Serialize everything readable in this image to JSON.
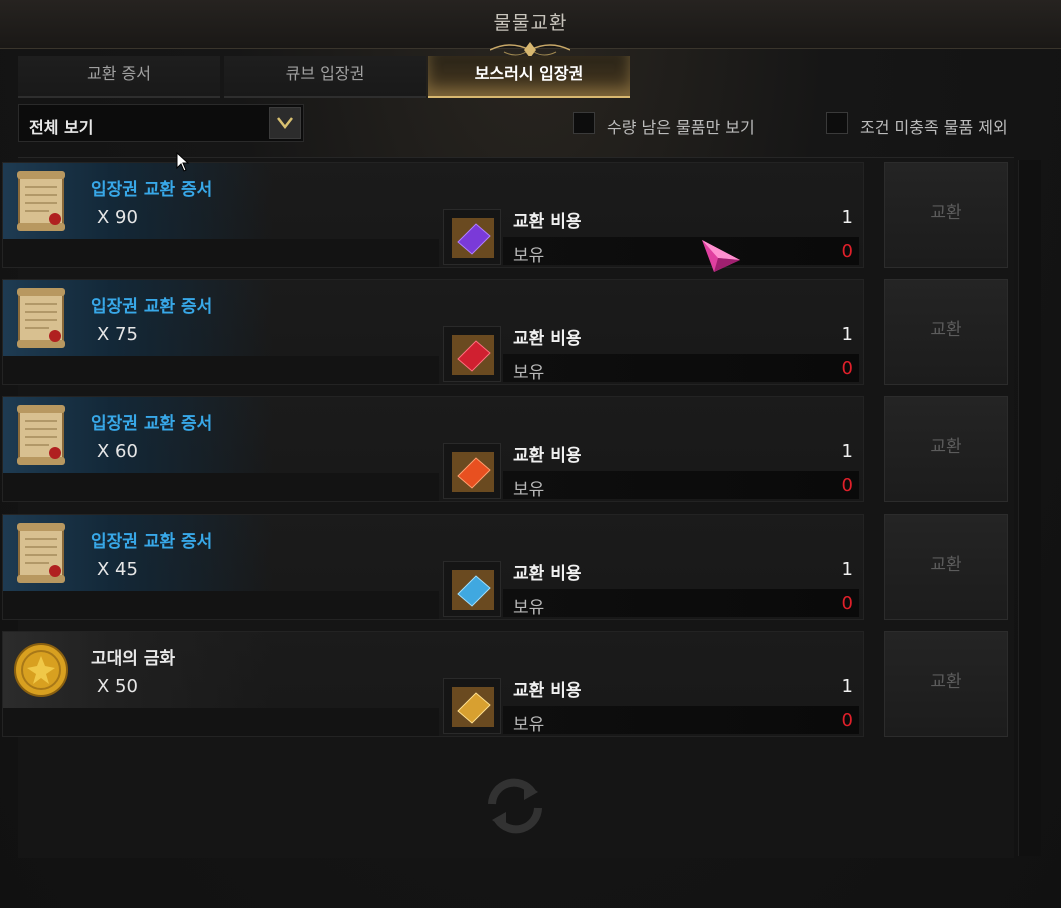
{
  "window": {
    "title": "물물교환"
  },
  "tabs": [
    {
      "label": "교환 증서",
      "active": false
    },
    {
      "label": "큐브 입장권",
      "active": false
    },
    {
      "label": "보스러시 입장권",
      "active": true
    }
  ],
  "filter": {
    "dropdown_value": "전체 보기",
    "checkbox_remaining": "수량 남은 물품만 보기",
    "checkbox_exclude": "조건 미충족 물품 제외"
  },
  "items": [
    {
      "name": "입장권 교환 증서",
      "qty": "X 90",
      "icon": "scroll-icon",
      "cost_label": "교환 비용",
      "cost": "1",
      "owned_label": "보유",
      "owned": "0",
      "cost_icon": "purple-ticket-icon",
      "button": "교환"
    },
    {
      "name": "입장권 교환 증서",
      "qty": "X 75",
      "icon": "scroll-icon",
      "cost_label": "교환 비용",
      "cost": "1",
      "owned_label": "보유",
      "owned": "0",
      "cost_icon": "red-ticket-icon",
      "button": "교환"
    },
    {
      "name": "입장권 교환 증서",
      "qty": "X 60",
      "icon": "scroll-icon",
      "cost_label": "교환 비용",
      "cost": "1",
      "owned_label": "보유",
      "owned": "0",
      "cost_icon": "orange-ticket-icon",
      "button": "교환"
    },
    {
      "name": "입장권 교환 증서",
      "qty": "X 45",
      "icon": "scroll-icon",
      "cost_label": "교환 비용",
      "cost": "1",
      "owned_label": "보유",
      "owned": "0",
      "cost_icon": "blue-ticket-icon",
      "button": "교환"
    },
    {
      "name": "고대의 금화",
      "qty": "X 50",
      "icon": "gold-coin-icon",
      "cost_label": "교환 비용",
      "cost": "1",
      "owned_label": "보유",
      "owned": "0",
      "cost_icon": "gold-ticket-icon",
      "button": "교환"
    }
  ],
  "colors": {
    "item_name": "#38a8e8",
    "owned_zero": "#e0202a",
    "tab_active_accent": "#d8b870",
    "ticket_purple": "#7a3ad8",
    "ticket_red": "#d02030",
    "ticket_orange": "#e85020",
    "ticket_blue": "#40a8e0",
    "ticket_gold": "#d8a030"
  }
}
